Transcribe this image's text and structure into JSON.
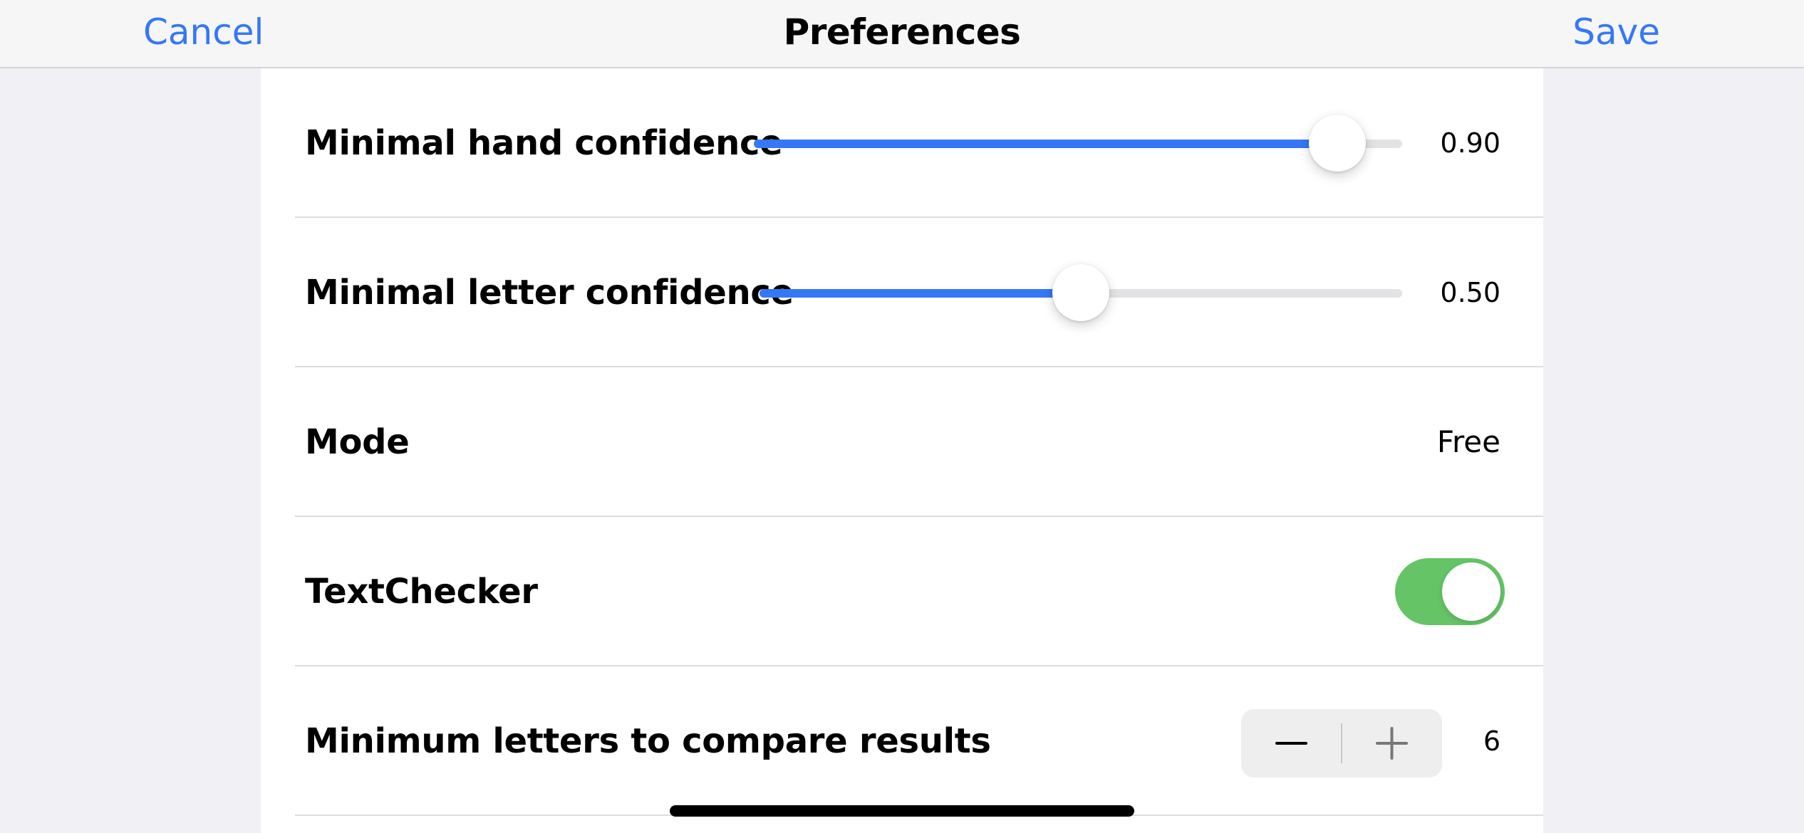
{
  "navbar": {
    "cancel_label": "Cancel",
    "title": "Preferences",
    "save_label": "Save"
  },
  "settings": {
    "hand_confidence": {
      "label": "Minimal hand confidence",
      "value": 0.9,
      "value_text": "0.90"
    },
    "letter_confidence": {
      "label": "Minimal letter confidence",
      "value": 0.5,
      "value_text": "0.50"
    },
    "mode": {
      "label": "Mode",
      "value": "Free"
    },
    "text_checker": {
      "label": "TextChecker",
      "enabled": true
    },
    "min_letters": {
      "label": "Minimum letters to compare results",
      "value": "6",
      "minus_icon": "minus-icon",
      "plus_icon": "plus-icon"
    }
  },
  "colors": {
    "accent": "#3478f6",
    "toggle_on": "#65c466",
    "background": "#f0f0f5"
  }
}
